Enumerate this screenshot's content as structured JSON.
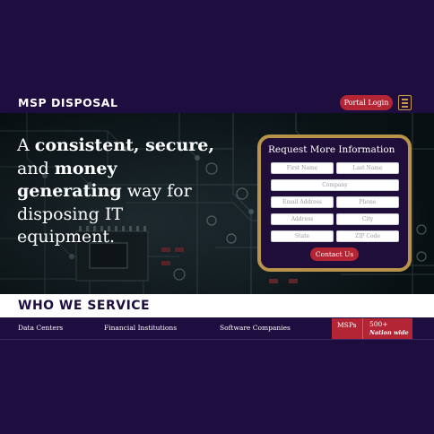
{
  "header": {
    "brand": "MSP DISPOSAL",
    "portal_login_label": "Portal Login",
    "menu_icon": "hamburger-menu-icon"
  },
  "hero": {
    "line1_a": "A ",
    "line1_b": "consistent, secure,",
    "line2_a": "and ",
    "line2_b": "money",
    "line3_a": "generating",
    "line3_b": " way for",
    "line4": "disposing IT",
    "line5": "equipment."
  },
  "form": {
    "title": "Request More Information",
    "first_name_placeholder": "First Name",
    "last_name_placeholder": "Last Name",
    "company_placeholder": "Company",
    "email_placeholder": "Email Address",
    "phone_placeholder": "Phone",
    "address_placeholder": "Address",
    "city_placeholder": "City",
    "state_placeholder": "State",
    "zip_placeholder": "ZIP Code",
    "submit_label": "Contact Us"
  },
  "who": {
    "title": "WHO WE SERVICE",
    "items": [
      "Data Centers",
      "Financial Institutions",
      "Software Companies"
    ],
    "stat_label": "MSPs",
    "stat_value": "500+",
    "stat_sub": "Nation wide"
  },
  "colors": {
    "navy": "#1e0d3f",
    "accent_red": "#b32534",
    "gold": "#b8944a"
  }
}
